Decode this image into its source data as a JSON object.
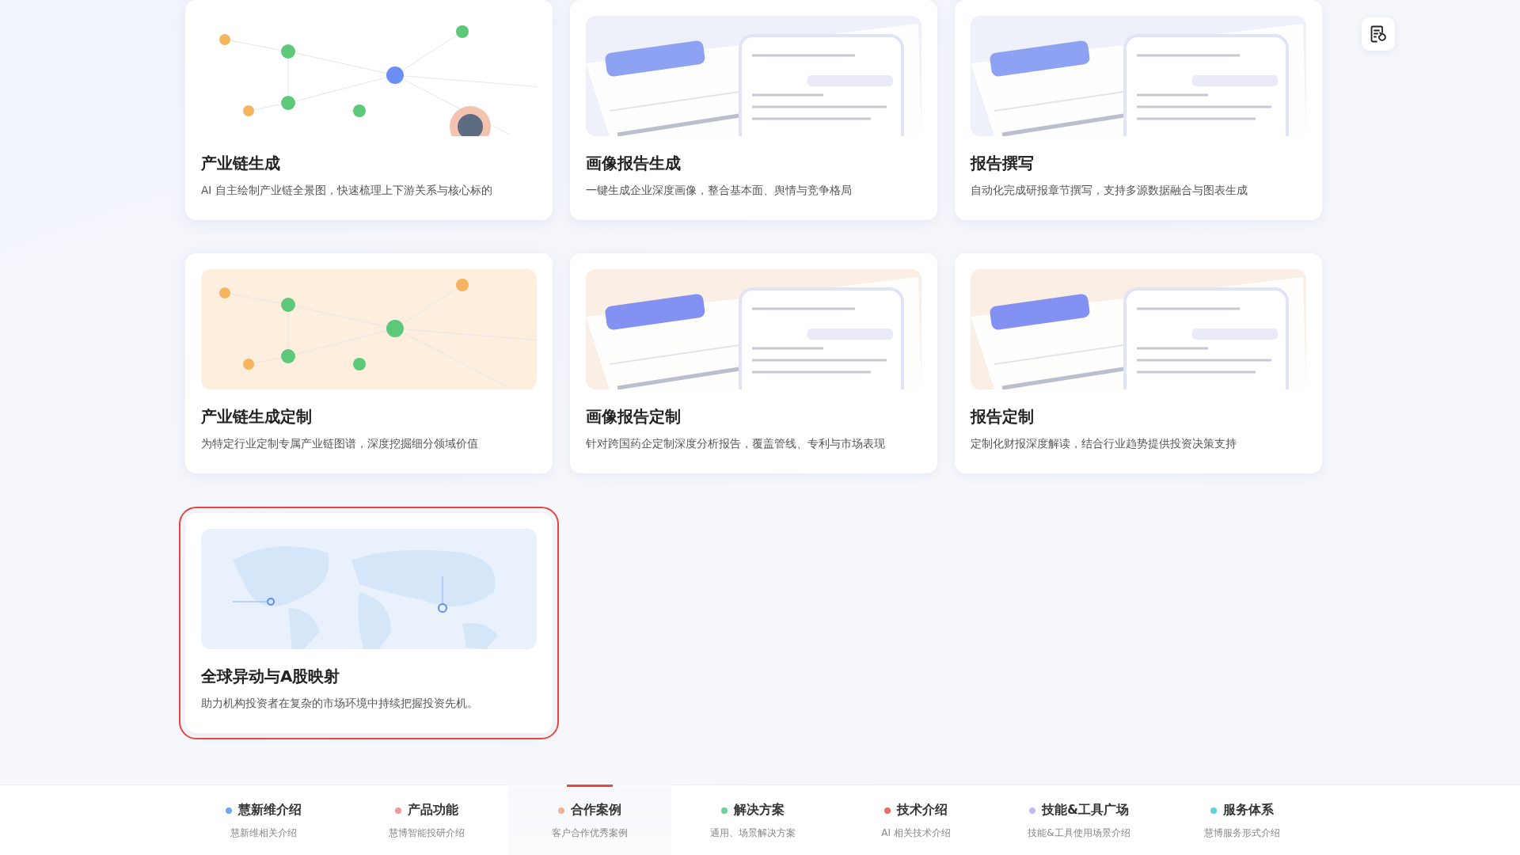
{
  "cards": [
    {
      "kind": "graph",
      "title": "产业链生成",
      "description": "AI 自主绘制产业链全景图，快速梳理上下游关系与核心标的",
      "selected": false
    },
    {
      "kind": "report",
      "title": "画像报告生成",
      "description": "一键生成企业深度画像，整合基本面、舆情与竞争格局",
      "selected": false
    },
    {
      "kind": "report",
      "title": "报告撰写",
      "description": "自动化完成研报章节撰写，支持多源数据融合与图表生成",
      "selected": false
    },
    {
      "kind": "graph-warm",
      "title": "产业链生成定制",
      "description": "为特定行业定制专属产业链图谱，深度挖掘细分领域价值",
      "selected": false
    },
    {
      "kind": "report-warm",
      "title": "画像报告定制",
      "description": "针对跨国药企定制深度分析报告，覆盖管线、专利与市场表现",
      "selected": false
    },
    {
      "kind": "report-warm",
      "title": "报告定制",
      "description": "定制化财报深度解读，结合行业趋势提供投资决策支持",
      "selected": false
    },
    {
      "kind": "map",
      "title": "全球异动与A股映射",
      "description": "助力机构投资者在复杂的市场环境中持续把握投资先机。",
      "selected": true
    }
  ],
  "nav": [
    {
      "label": "慧新维介绍",
      "sublabel": "慧新维相关介绍",
      "color": "#6ea8f5",
      "selected": false
    },
    {
      "label": "产品功能",
      "sublabel": "慧博智能投研介绍",
      "color": "#f19a9a",
      "selected": false
    },
    {
      "label": "合作案例",
      "sublabel": "客户合作优秀案例",
      "color": "#f5b09a",
      "selected": true
    },
    {
      "label": "解决方案",
      "sublabel": "通用、场景解决方案",
      "color": "#6dd09a",
      "selected": false
    },
    {
      "label": "技术介绍",
      "sublabel": "AI 相关技术介绍",
      "color": "#f06a6a",
      "selected": false
    },
    {
      "label": "技能&工具广场",
      "sublabel": "技能&工具使用场景介绍",
      "color": "#c4b8f5",
      "selected": false
    },
    {
      "label": "服务体系",
      "sublabel": "慧博服务形式介绍",
      "color": "#5fd0dc",
      "selected": false
    }
  ]
}
